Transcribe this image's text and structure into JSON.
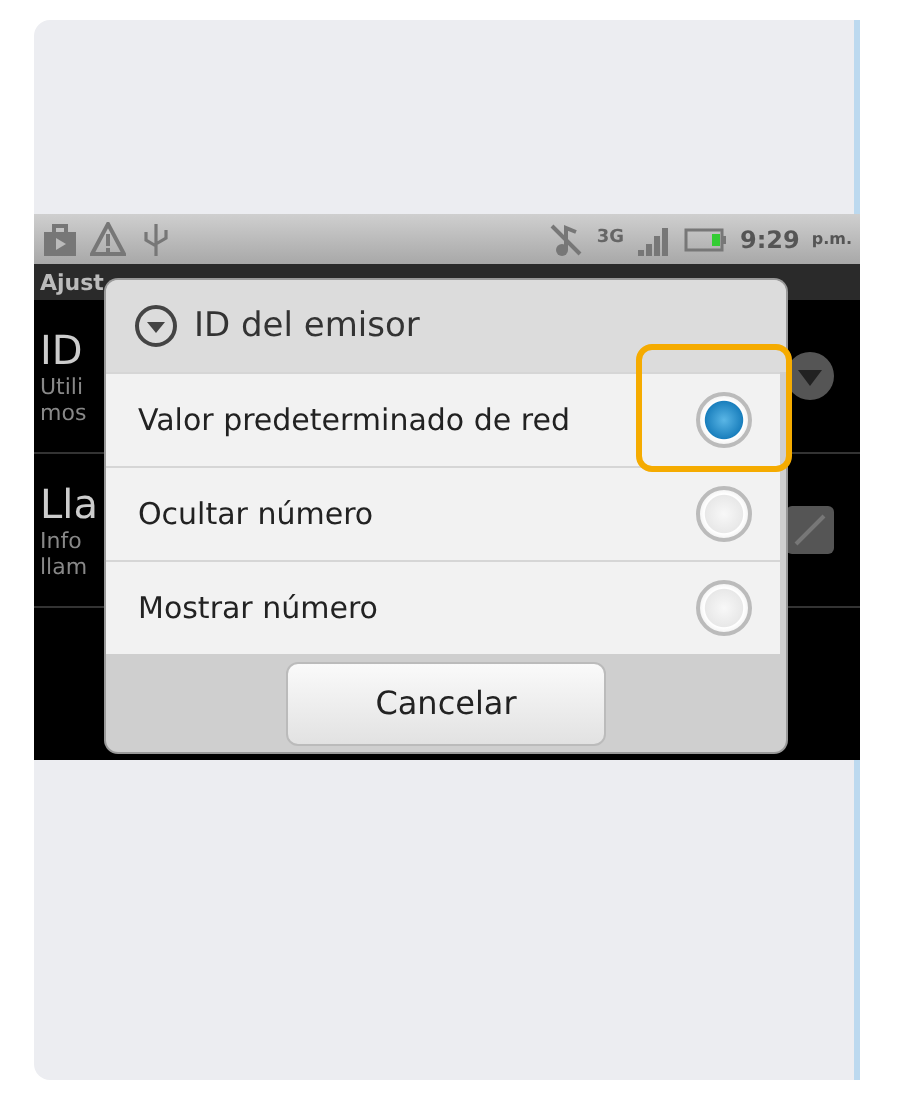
{
  "status_bar": {
    "network": "3G",
    "time": "9:29",
    "time_suffix": "p.m."
  },
  "settings": {
    "header": "Ajust",
    "items": [
      {
        "kind": "dropdown",
        "title": "ID",
        "lines": [
          "Utili",
          "mos"
        ]
      },
      {
        "kind": "checkbox",
        "title": "Lla",
        "lines": [
          "Info",
          "llam"
        ]
      }
    ]
  },
  "dialog": {
    "title": "ID del emisor",
    "options": [
      {
        "label": "Valor predeterminado de red",
        "selected": true
      },
      {
        "label": "Ocultar número",
        "selected": false
      },
      {
        "label": "Mostrar número",
        "selected": false
      }
    ],
    "button": "Cancelar"
  }
}
